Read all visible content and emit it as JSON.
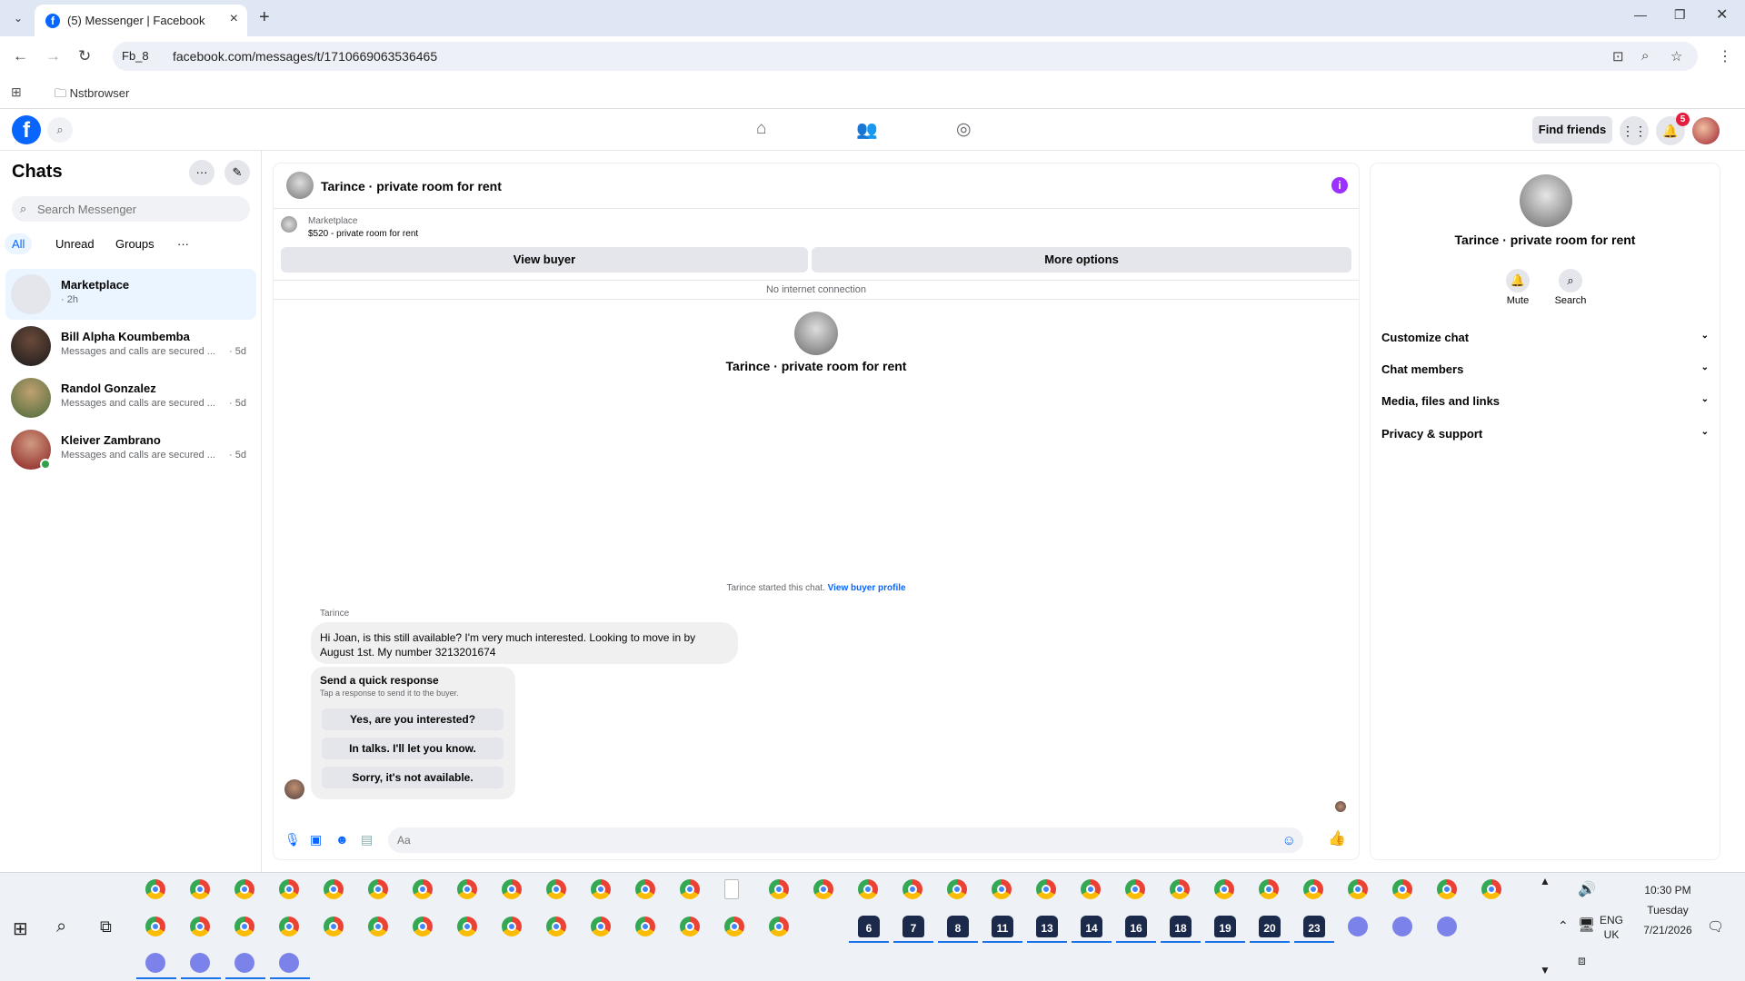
{
  "browser": {
    "tab_title": "(5) Messenger | Facebook",
    "site_chip": "Fb_8",
    "url": "facebook.com/messages/t/1710669063536465",
    "bookmark_folder": "Nstbrowser"
  },
  "fb": {
    "logo": "f",
    "find_friends": "Find friends",
    "notifications_count": "5"
  },
  "sidebar": {
    "title": "Chats",
    "search_placeholder": "Search Messenger",
    "filters": [
      "All",
      "Unread",
      "Groups",
      "···"
    ],
    "chats": [
      {
        "name": "Marketplace",
        "preview": "· 2h",
        "time": "",
        "active": true
      },
      {
        "name": "Bill Alpha Koumbemba",
        "preview": "Messages and calls are secured ...",
        "time": "· 5d"
      },
      {
        "name": "Randol Gonzalez",
        "preview": "Messages and calls are secured ...",
        "time": "· 5d"
      },
      {
        "name": "Kleiver Zambrano",
        "preview": "Messages and calls are secured ...",
        "time": "· 5d"
      }
    ]
  },
  "conversation": {
    "title": "Tarince · private room for rent",
    "marketplace_label": "Marketplace",
    "listing": "$520 - private room for rent",
    "view_buyer": "View buyer",
    "more_options": "More options",
    "no_connection": "No internet connection",
    "profile_name": "Tarince · private room for rent",
    "started_text": "Tarince started this chat.",
    "view_buyer_profile": "View buyer profile",
    "sender": "Tarince",
    "message": "Hi Joan, is this still available? I'm very much interested. Looking to move in by August 1st. My number 3213201674",
    "quick_title": "Send a quick response",
    "quick_subtitle": "Tap a response to send it to the buyer.",
    "quick_responses": [
      "Yes, are you interested?",
      "In talks. I'll let you know.",
      "Sorry, it's not available."
    ],
    "composer_placeholder": "Aa"
  },
  "info_panel": {
    "name": "Tarince · private room for rent",
    "mute": "Mute",
    "search": "Search",
    "sections": [
      "Customize chat",
      "Chat members",
      "Media, files and links",
      "Privacy & support"
    ]
  },
  "taskbar": {
    "time": "10:30 PM",
    "day": "Tuesday",
    "date": "7/21/2026",
    "lang1": "ENG",
    "lang2": "UK",
    "numbered_apps": [
      "6",
      "7",
      "8",
      "11",
      "13",
      "14",
      "16",
      "18",
      "19",
      "20",
      "23"
    ]
  }
}
